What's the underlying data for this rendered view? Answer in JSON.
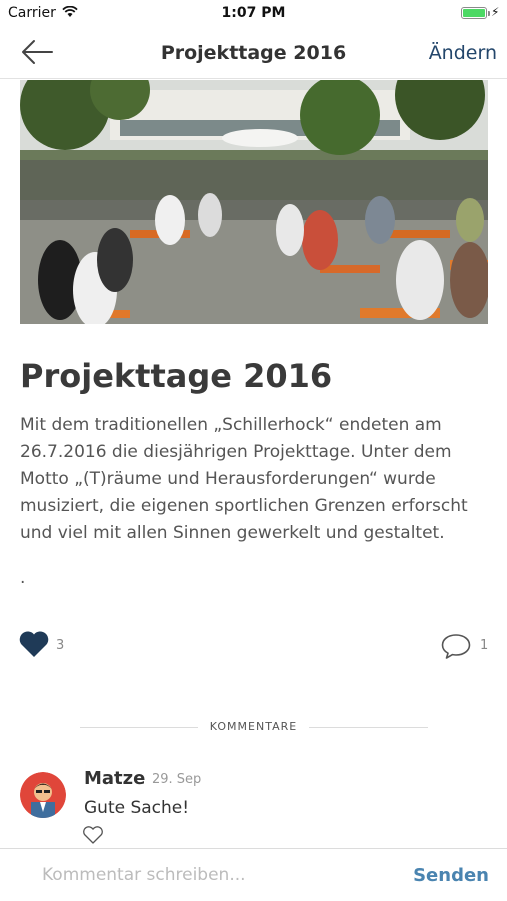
{
  "status_bar": {
    "carrier": "Carrier",
    "time": "1:07 PM",
    "battery_level": 1.0,
    "battery_color": "#4cd964"
  },
  "nav": {
    "back_icon": "arrow-left-icon",
    "title": "Projekttage 2016",
    "edit_label": "Ändern"
  },
  "article": {
    "image": "photo of students sitting at outdoor beer tables in a schoolyard",
    "headline": "Projekttage 2016",
    "body": "Mit dem traditionellen „Schillerhock“ endeten am 26.7.2016 die diesjährigen Projekttage. Unter dem Motto „(T)räume und Herausforderungen“ wurde musiziert, die eigenen sportlichen Grenzen erforscht und viel mit allen Sinnen gewerkelt und gestaltet.",
    "trailing": ".",
    "like_count": "3",
    "comment_count": "1"
  },
  "comments_section": {
    "label": "KOMMENTARE",
    "items": [
      {
        "author": "Matze",
        "date": "29. Sep",
        "text": "Gute Sache!"
      }
    ]
  },
  "input": {
    "placeholder": "Kommentar schreiben...",
    "send_label": "Senden"
  },
  "colors": {
    "accent": "#23466b",
    "send": "#4a84b0",
    "heart": "#1f3a57"
  }
}
